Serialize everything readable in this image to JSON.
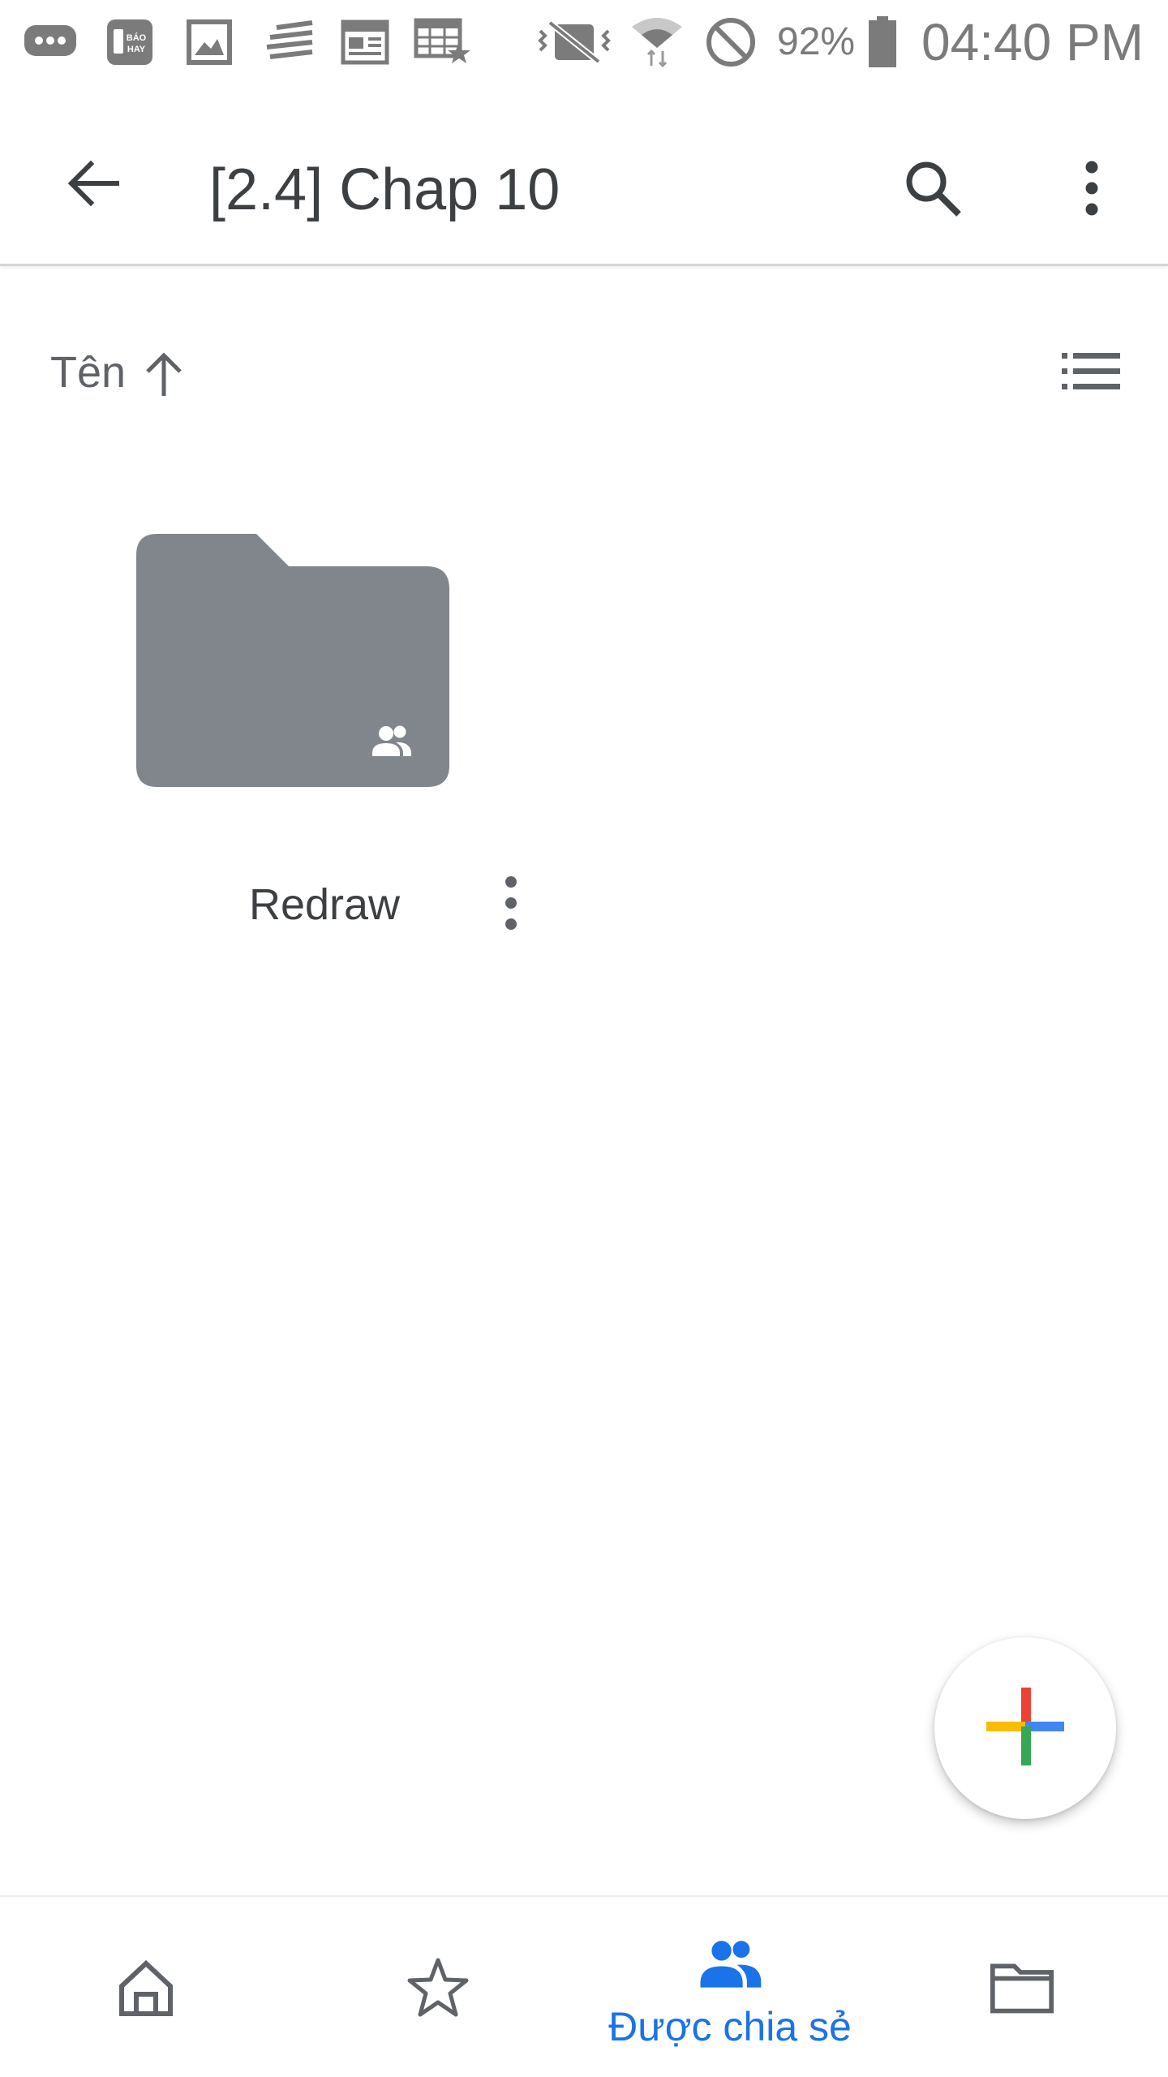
{
  "status_bar": {
    "battery_percent": "92%",
    "time": "04:40 PM",
    "notification_icons": [
      "chat-icon",
      "bao-hay-app-icon",
      "image-icon",
      "news-lines-icon",
      "newspaper-icon",
      "calendar-star-icon"
    ],
    "system_icons": [
      "vibrate-off-icon",
      "wifi-icon",
      "do-not-disturb-icon",
      "battery-icon"
    ],
    "bao_hay_text": "BÁO HAY"
  },
  "app_bar": {
    "title": "[2.4] Chap 10",
    "back_icon": "arrow-back-icon",
    "search_icon": "search-icon",
    "more_icon": "more-vert-icon"
  },
  "sort": {
    "label": "Tên",
    "direction_icon": "arrow-up-icon",
    "view_icon": "list-view-icon"
  },
  "items": [
    {
      "name": "Redraw",
      "type": "shared-folder",
      "icon": "shared-folder-icon"
    }
  ],
  "fab": {
    "icon": "plus-icon",
    "colors": {
      "red": "#ea4335",
      "blue": "#4285f4",
      "yellow": "#fbbc04",
      "green": "#34a853"
    }
  },
  "bottom_nav": {
    "active_color": "#1a73e8",
    "items": [
      {
        "icon": "home-icon",
        "label": ""
      },
      {
        "icon": "star-icon",
        "label": ""
      },
      {
        "icon": "people-icon",
        "label": "Được chia sẻ",
        "active": true
      },
      {
        "icon": "folder-icon",
        "label": ""
      }
    ]
  },
  "colors": {
    "folder_gray": "#80868b",
    "icon_gray": "#5f6368",
    "accent_blue": "#1a73e8"
  }
}
